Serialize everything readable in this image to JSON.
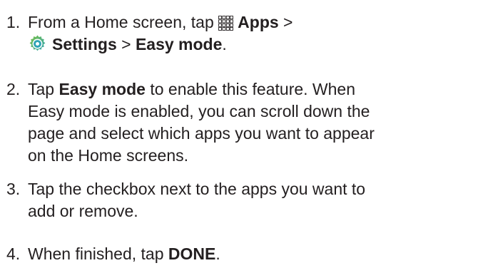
{
  "steps": [
    {
      "number": "1.",
      "line1_a": "From a Home screen, tap ",
      "apps_label": "Apps",
      "line1_b": " >",
      "apps_icon": "apps-grid-icon",
      "settings_icon": "settings-gear-icon",
      "settings_label": "Settings",
      "sep": " > ",
      "easy_mode_label": "Easy mode",
      "period": "."
    },
    {
      "number": "2.",
      "tap": "Tap ",
      "easy_mode_label": "Easy mode",
      "line1_rest": " to enable this feature. When",
      "line2": "Easy mode is enabled, you can scroll down the",
      "line3": "page and select which apps you want to appear",
      "line4": "on the Home screens."
    },
    {
      "number": "3.",
      "line1": "Tap the checkbox next to the apps you want to",
      "line2": "add or remove."
    },
    {
      "number": "4.",
      "text": "When finished, tap ",
      "done_label": "DONE",
      "period": "."
    }
  ],
  "colors": {
    "text": "#231f20",
    "icon_teal": "#2fa4b5",
    "icon_green": "#7cc242"
  }
}
